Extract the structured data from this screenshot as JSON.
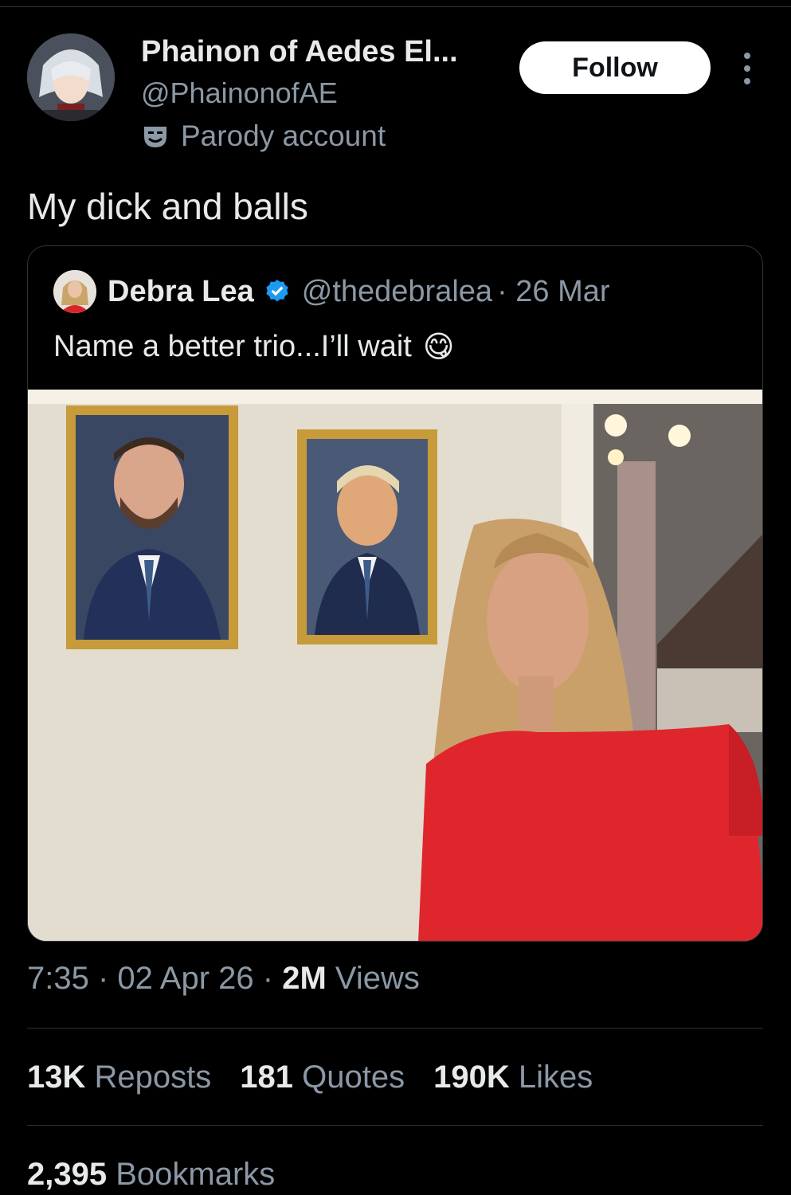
{
  "author": {
    "name": "Phainon of Aedes El...",
    "handle": "@PhainonofAE",
    "label": "Parody account",
    "label_icon": "parody-mask-icon"
  },
  "actions": {
    "follow_label": "Follow",
    "more_icon": "more-options-icon"
  },
  "tweet": {
    "text": "My dick and balls"
  },
  "quoted": {
    "name": "Debra Lea",
    "handle": "@thedebralea",
    "date": "· 26 Mar",
    "text": "Name a better trio...I’ll wait",
    "emoji": "😋",
    "verified_icon": "verified-badge-icon"
  },
  "meta": {
    "time": "7:35",
    "date": "02 Apr 26",
    "views_count": "2M",
    "views_label": "Views"
  },
  "stats": {
    "reposts_count": "13K",
    "reposts_label": "Reposts",
    "quotes_count": "181",
    "quotes_label": "Quotes",
    "likes_count": "190K",
    "likes_label": "Likes",
    "bookmarks_count": "2,395",
    "bookmarks_label": "Bookmarks"
  },
  "colors": {
    "background": "#000000",
    "text": "#e7e9ea",
    "secondary": "#8b98a5",
    "verified": "#1d9bf0",
    "border": "#2f3336"
  }
}
